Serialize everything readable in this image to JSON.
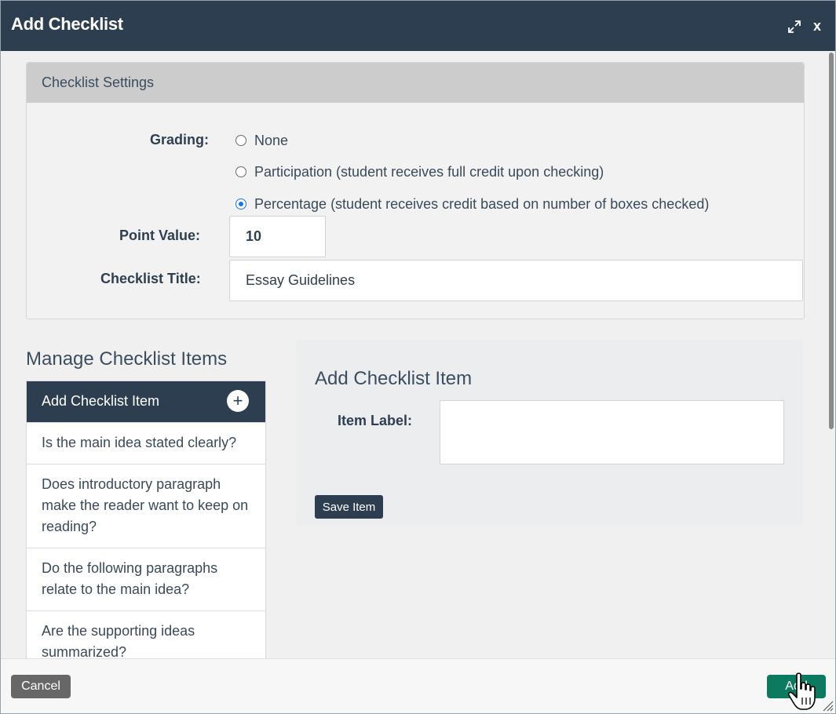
{
  "dialog": {
    "title": "Add Checklist",
    "expand_icon": "expand-icon",
    "close_label": "x"
  },
  "settings": {
    "header": "Checklist Settings",
    "grading_label": "Grading:",
    "grading_options": [
      {
        "label": "None",
        "checked": false
      },
      {
        "label": "Participation (student receives full credit upon checking)",
        "checked": false
      },
      {
        "label": "Percentage (student receives credit based on number of boxes checked)",
        "checked": true
      }
    ],
    "point_value_label": "Point Value:",
    "point_value": "10",
    "title_label": "Checklist Title:",
    "title_value": "Essay Guidelines"
  },
  "manage": {
    "title": "Manage Checklist Items",
    "add_header": "Add Checklist Item",
    "plus_label": "+",
    "items": [
      "Is the main idea stated clearly?",
      "Does introductory paragraph make the reader want to keep on reading?",
      "Do the following paragraphs relate to the main idea?",
      "Are the supporting ideas summarized?"
    ]
  },
  "add_item": {
    "heading": "Add Checklist Item",
    "label": "Item Label:",
    "value": "",
    "save_label": "Save Item"
  },
  "footer": {
    "cancel_label": "Cancel",
    "add_label": "Add"
  },
  "colors": {
    "titlebar": "#2d3e50",
    "add_button": "#0c7a5e",
    "cancel_button": "#676767",
    "radio_checked": "#1a73e8"
  }
}
